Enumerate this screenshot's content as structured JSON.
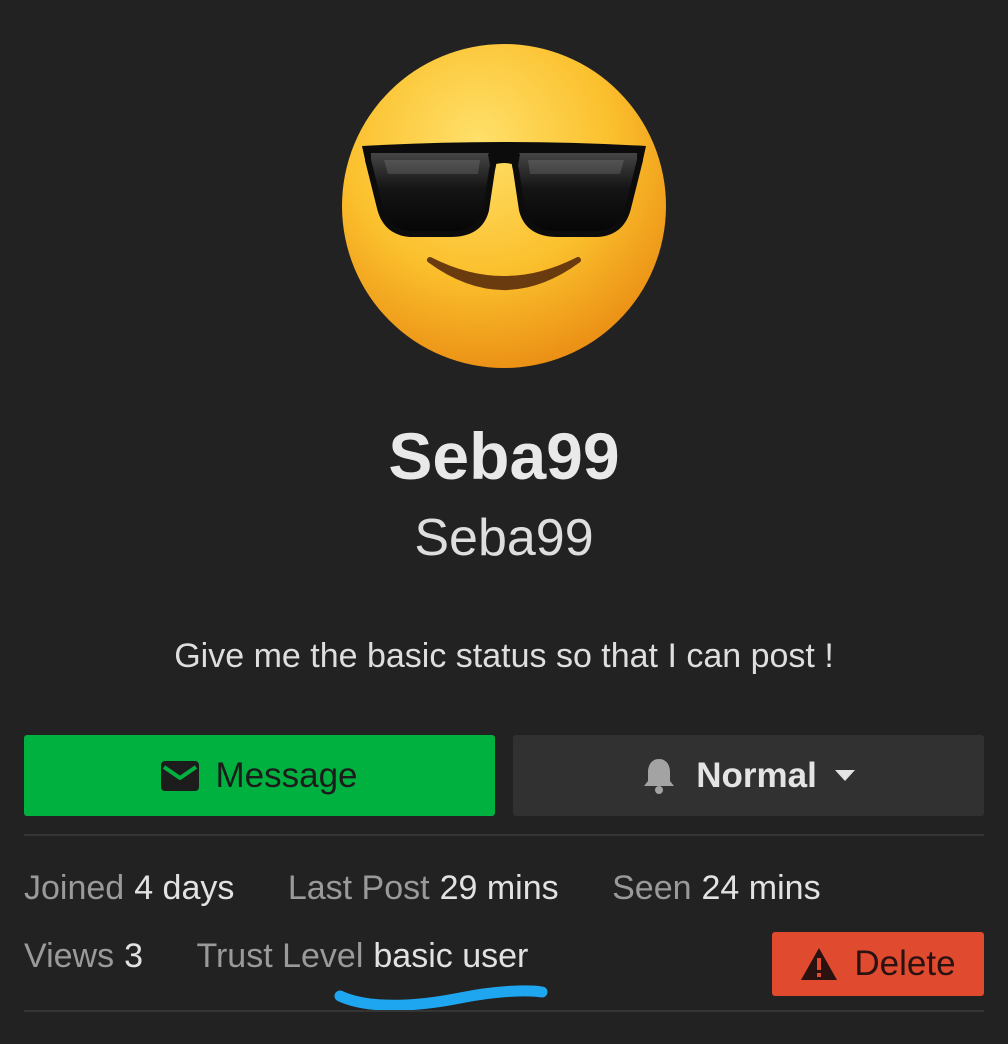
{
  "profile": {
    "avatar_icon": "sunglasses-emoji-icon",
    "display_name": "Seba99",
    "username": "Seba99",
    "bio": "Give me the basic status so that I can post !"
  },
  "actions": {
    "message_label": "Message",
    "message_icon": "envelope-icon",
    "notification_level": "Normal",
    "notification_icon": "bell-icon",
    "delete_label": "Delete",
    "delete_icon": "warning-icon"
  },
  "stats": {
    "joined_label": "Joined",
    "joined_value": "4 days",
    "last_post_label": "Last Post",
    "last_post_value": "29 mins",
    "seen_label": "Seen",
    "seen_value": "24 mins",
    "views_label": "Views",
    "views_value": "3",
    "trust_level_label": "Trust Level",
    "trust_level_value": "basic user"
  },
  "colors": {
    "background": "#222222",
    "message_button": "#00b140",
    "notify_button": "#313131",
    "delete_button": "#e04a2f",
    "annotation_underline": "#1ea7f0"
  }
}
